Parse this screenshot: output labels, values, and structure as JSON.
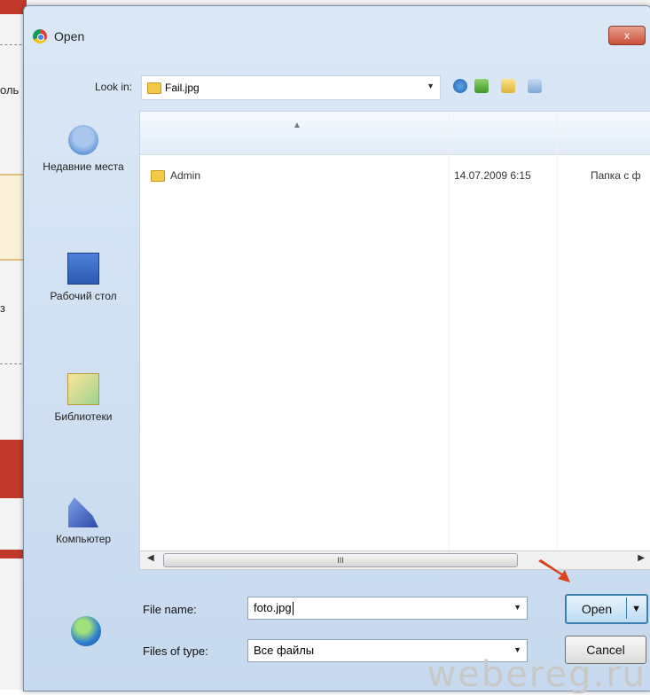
{
  "background": {
    "side_text_top": "оль",
    "side_text_mid": "з",
    "watermark": "webereg.ru"
  },
  "dialog": {
    "title": "Open",
    "close_label": "x"
  },
  "address": {
    "look_in_label": "Look in:",
    "path": "Fail.jpg"
  },
  "places": [
    {
      "id": "recent",
      "label": "Недавние места"
    },
    {
      "id": "desktop",
      "label": "Рабочий стол"
    },
    {
      "id": "libraries",
      "label": "Библиотеки"
    },
    {
      "id": "computer",
      "label": "Компьютер"
    },
    {
      "id": "network",
      "label": ""
    }
  ],
  "file_list": {
    "rows": [
      {
        "name": "Admin",
        "date": "14.07.2009 6:15",
        "type": "Папка с ф"
      }
    ],
    "scroll_thumb_label": "III"
  },
  "form": {
    "file_name_label": "File name:",
    "file_name_value": "foto.jpg",
    "file_type_label": "Files of type:",
    "file_type_value": "Все файлы",
    "open_label": "Open",
    "cancel_label": "Cancel"
  },
  "colors": {
    "accent": "#3c7fb1",
    "pointer_arrow": "#d9431e"
  }
}
